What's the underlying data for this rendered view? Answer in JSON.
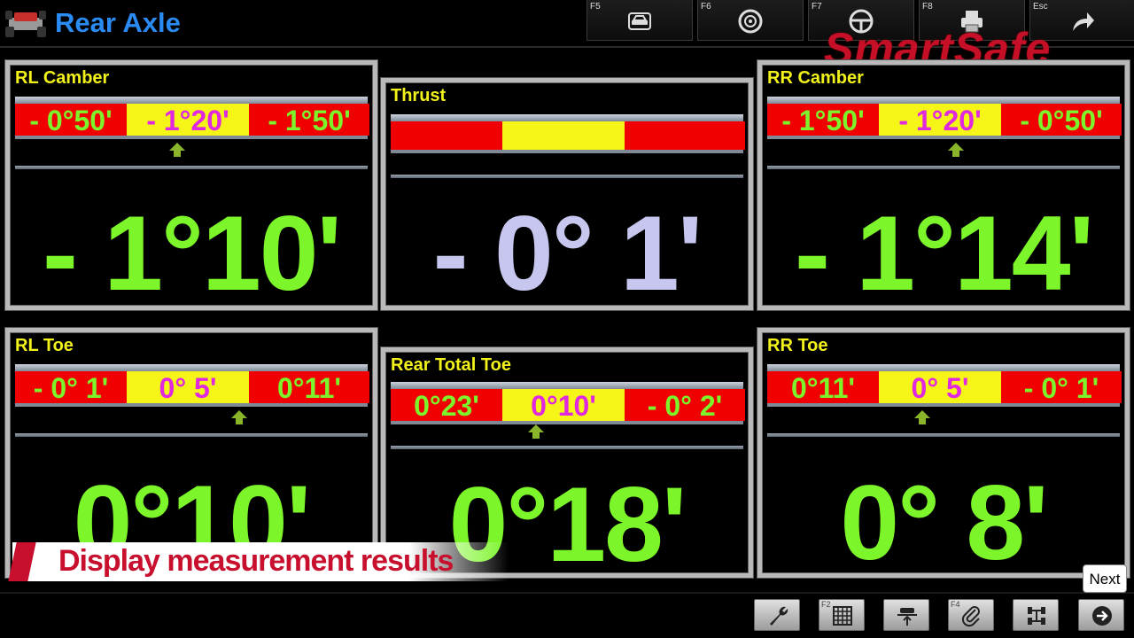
{
  "header": {
    "title": "Rear Axle",
    "brand": "SmartSafe",
    "fkeys": [
      {
        "key": "F5",
        "icon": "car-icon"
      },
      {
        "key": "F6",
        "icon": "wheel-icon"
      },
      {
        "key": "F7",
        "icon": "steering-wheel-icon"
      },
      {
        "key": "F8",
        "icon": "printer-icon"
      },
      {
        "key": "Esc",
        "icon": "exit-arrow-icon"
      }
    ]
  },
  "panels": {
    "rl_camber": {
      "title": "RL Camber",
      "min": "- 0°50'",
      "mid": "- 1°20'",
      "max": "- 1°50'",
      "value": "- 1°10'"
    },
    "thrust": {
      "title": "Thrust",
      "value": "- 0° 1'"
    },
    "rr_camber": {
      "title": "RR Camber",
      "min": "- 1°50'",
      "mid": "- 1°20'",
      "max": "- 0°50'",
      "value": "- 1°14'"
    },
    "rl_toe": {
      "title": "RL Toe",
      "min": "- 0° 1'",
      "mid": "0° 5'",
      "max": "0°11'",
      "value": "0°10'"
    },
    "rear_total_toe": {
      "title": "Rear Total Toe",
      "min": "0°23'",
      "mid": "0°10'",
      "max": "- 0° 2'",
      "value": "0°18'"
    },
    "rr_toe": {
      "title": "RR Toe",
      "min": "0°11'",
      "mid": "0° 5'",
      "max": "- 0° 1'",
      "value": "0° 8'"
    }
  },
  "caption": "Display measurement results",
  "bottombar": {
    "buttons": [
      {
        "key": "",
        "icon": "wrench-icon"
      },
      {
        "key": "F2",
        "icon": "grid-icon"
      },
      {
        "key": "",
        "icon": "lift-icon"
      },
      {
        "key": "F4",
        "icon": "paperclip-icon"
      },
      {
        "key": "",
        "icon": "axle-icon"
      },
      {
        "key": "",
        "icon": "next-arrow-icon"
      }
    ],
    "next_tooltip": "Next"
  },
  "colors": {
    "title_blue": "#2a8bf2",
    "label_yellow": "#f2f21a",
    "value_green": "#7cf52a",
    "range_red": "#f00000",
    "range_yellow": "#f5f518",
    "mid_magenta": "#e028e0",
    "thrust_lavender": "#c6c6ee",
    "brand_red": "#d0102a"
  }
}
